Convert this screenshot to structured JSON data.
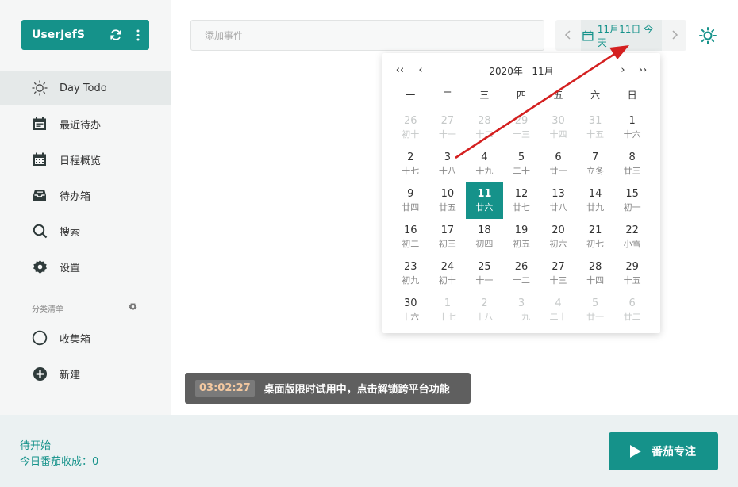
{
  "sidebar": {
    "user_name": "UserJefS",
    "nav": [
      {
        "label": "Day Todo",
        "icon": "sun-icon",
        "active": true
      },
      {
        "label": "最近待办",
        "icon": "calendar-icon"
      },
      {
        "label": "日程概览",
        "icon": "calendar-grid-icon"
      },
      {
        "label": "待办箱",
        "icon": "inbox-icon"
      },
      {
        "label": "搜索",
        "icon": "search-icon"
      },
      {
        "label": "设置",
        "icon": "gear-icon"
      }
    ],
    "section_title": "分类清单",
    "lists": [
      {
        "label": "收集箱",
        "icon": "circle-icon"
      },
      {
        "label": "新建",
        "icon": "plus-circle-icon"
      }
    ]
  },
  "topbar": {
    "add_placeholder": "添加事件",
    "current_date": "11月11日 今天"
  },
  "calendar": {
    "year": "2020年",
    "month": "11月",
    "weekdays": [
      "一",
      "二",
      "三",
      "四",
      "五",
      "六",
      "日"
    ],
    "selected": "11",
    "weeks": [
      [
        {
          "d": "26",
          "l": "初十",
          "m": true
        },
        {
          "d": "27",
          "l": "十一",
          "m": true
        },
        {
          "d": "28",
          "l": "十二",
          "m": true
        },
        {
          "d": "29",
          "l": "十三",
          "m": true
        },
        {
          "d": "30",
          "l": "十四",
          "m": true
        },
        {
          "d": "31",
          "l": "十五",
          "m": true
        },
        {
          "d": "1",
          "l": "十六"
        }
      ],
      [
        {
          "d": "2",
          "l": "十七"
        },
        {
          "d": "3",
          "l": "十八"
        },
        {
          "d": "4",
          "l": "十九"
        },
        {
          "d": "5",
          "l": "二十"
        },
        {
          "d": "6",
          "l": "廿一"
        },
        {
          "d": "7",
          "l": "立冬"
        },
        {
          "d": "8",
          "l": "廿三"
        }
      ],
      [
        {
          "d": "9",
          "l": "廿四"
        },
        {
          "d": "10",
          "l": "廿五"
        },
        {
          "d": "11",
          "l": "廿六",
          "s": true
        },
        {
          "d": "12",
          "l": "廿七"
        },
        {
          "d": "13",
          "l": "廿八"
        },
        {
          "d": "14",
          "l": "廿九"
        },
        {
          "d": "15",
          "l": "初一"
        }
      ],
      [
        {
          "d": "16",
          "l": "初二"
        },
        {
          "d": "17",
          "l": "初三"
        },
        {
          "d": "18",
          "l": "初四"
        },
        {
          "d": "19",
          "l": "初五"
        },
        {
          "d": "20",
          "l": "初六"
        },
        {
          "d": "21",
          "l": "初七"
        },
        {
          "d": "22",
          "l": "小雪"
        }
      ],
      [
        {
          "d": "23",
          "l": "初九"
        },
        {
          "d": "24",
          "l": "初十"
        },
        {
          "d": "25",
          "l": "十一"
        },
        {
          "d": "26",
          "l": "十二"
        },
        {
          "d": "27",
          "l": "十三"
        },
        {
          "d": "28",
          "l": "十四"
        },
        {
          "d": "29",
          "l": "十五"
        }
      ],
      [
        {
          "d": "30",
          "l": "十六"
        },
        {
          "d": "1",
          "l": "十七",
          "m": true
        },
        {
          "d": "2",
          "l": "十八",
          "m": true
        },
        {
          "d": "3",
          "l": "十九",
          "m": true
        },
        {
          "d": "4",
          "l": "二十",
          "m": true
        },
        {
          "d": "5",
          "l": "廿一",
          "m": true
        },
        {
          "d": "6",
          "l": "廿二",
          "m": true
        }
      ]
    ]
  },
  "trial": {
    "timer": "03:02:27",
    "message": "桌面版限时试用中，点击解锁跨平台功能"
  },
  "footer": {
    "status": "待开始",
    "count": "今日番茄收成：0",
    "focus_label": "番茄专注"
  },
  "colors": {
    "accent": "#15928a",
    "arrow": "#d42020"
  }
}
